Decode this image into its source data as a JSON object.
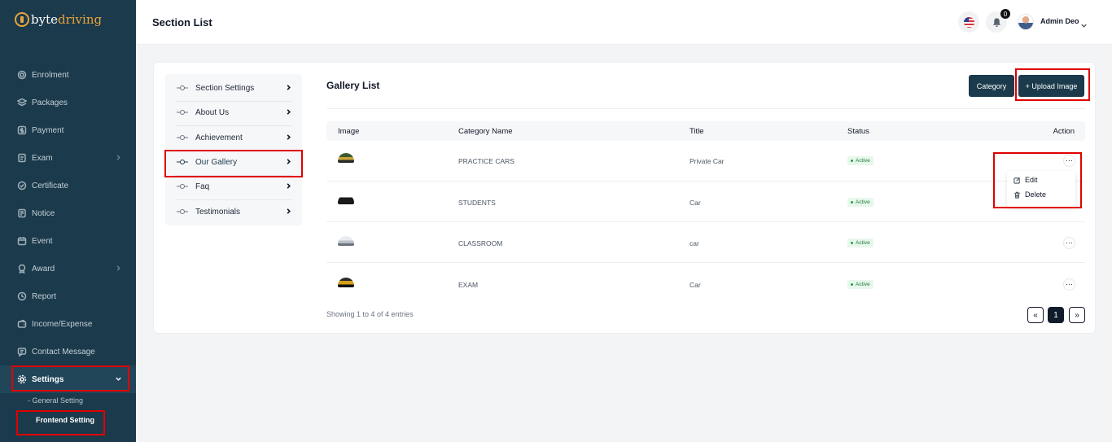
{
  "brand": {
    "part1": "byte",
    "part2": "driving"
  },
  "sidebar": {
    "items": [
      {
        "label": "Enrolment",
        "icon": "layers-icon",
        "chevron": false
      },
      {
        "label": "Packages",
        "icon": "stack-icon",
        "chevron": false
      },
      {
        "label": "Payment",
        "icon": "dollar-icon",
        "chevron": false
      },
      {
        "label": "Exam",
        "icon": "clipboard-icon",
        "chevron": true
      },
      {
        "label": "Certificate",
        "icon": "certificate-icon",
        "chevron": false
      },
      {
        "label": "Notice",
        "icon": "notice-icon",
        "chevron": false
      },
      {
        "label": "Event",
        "icon": "calendar-icon",
        "chevron": false
      },
      {
        "label": "Award",
        "icon": "award-icon",
        "chevron": true
      },
      {
        "label": "Report",
        "icon": "report-icon",
        "chevron": false
      },
      {
        "label": "Income/Expense",
        "icon": "wallet-icon",
        "chevron": false
      },
      {
        "label": "Contact Message",
        "icon": "message-icon",
        "chevron": false
      },
      {
        "label": "Settings",
        "icon": "gear-icon",
        "chevron": true,
        "expanded": true
      }
    ],
    "sub_items": {
      "general": "General Setting",
      "frontend": "Frontend Setting"
    }
  },
  "header": {
    "title": "Section List",
    "notification_count": "0",
    "user_name": "Admin Deo"
  },
  "section_menu": {
    "items": [
      {
        "label": "Section Settings"
      },
      {
        "label": "About Us"
      },
      {
        "label": "Achievement"
      },
      {
        "label": "Our Gallery",
        "active": true
      },
      {
        "label": "Faq"
      },
      {
        "label": "Testimonials"
      }
    ]
  },
  "gallery": {
    "title": "Gallery List",
    "category_button": "Category",
    "upload_button": "+ Upload Image",
    "columns": {
      "image": "Image",
      "category": "Category Name",
      "title": "Title",
      "status": "Status",
      "action": "Action"
    },
    "rows": [
      {
        "category": "PRACTICE CARS",
        "title": "Private Car",
        "status": "Active"
      },
      {
        "category": "STUDENTS",
        "title": "Car",
        "status": "Active"
      },
      {
        "category": "CLASSROOM",
        "title": "car",
        "status": "Active"
      },
      {
        "category": "EXAM",
        "title": "Car",
        "status": "Active"
      }
    ],
    "action_menu": {
      "edit": "Edit",
      "delete": "Delete"
    },
    "more_glyph": "···",
    "footer": "Showing 1 to 4 of 4 entries",
    "pagination": {
      "prev": "«",
      "current": "1",
      "next": "»"
    }
  },
  "colors": {
    "sidebar_bg": "#1b3a4b",
    "accent": "#e8a33d",
    "primary_button": "#1b3a4b",
    "highlight_box": "#e00000",
    "status_active": "#22a04b"
  }
}
